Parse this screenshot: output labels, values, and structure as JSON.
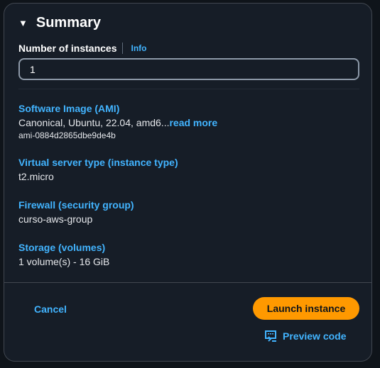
{
  "summary": {
    "title": "Summary",
    "instances_label": "Number of instances",
    "info_link": "Info",
    "instances_value": "1",
    "sections": [
      {
        "title": "Software Image (AMI)",
        "value": "Canonical, Ubuntu, 22.04, amd6...",
        "read_more": "read more",
        "sub": "ami-0884d2865dbe9de4b"
      },
      {
        "title": "Virtual server type (instance type)",
        "value": "t2.micro"
      },
      {
        "title": "Firewall (security group)",
        "value": "curso-aws-group"
      },
      {
        "title": "Storage (volumes)",
        "value": "1 volume(s) - 16 GiB"
      }
    ]
  },
  "footer": {
    "cancel": "Cancel",
    "launch": "Launch instance",
    "preview": "Preview code"
  },
  "colors": {
    "accent": "#ff9900",
    "link": "#42b4ff",
    "background": "#161d27"
  }
}
